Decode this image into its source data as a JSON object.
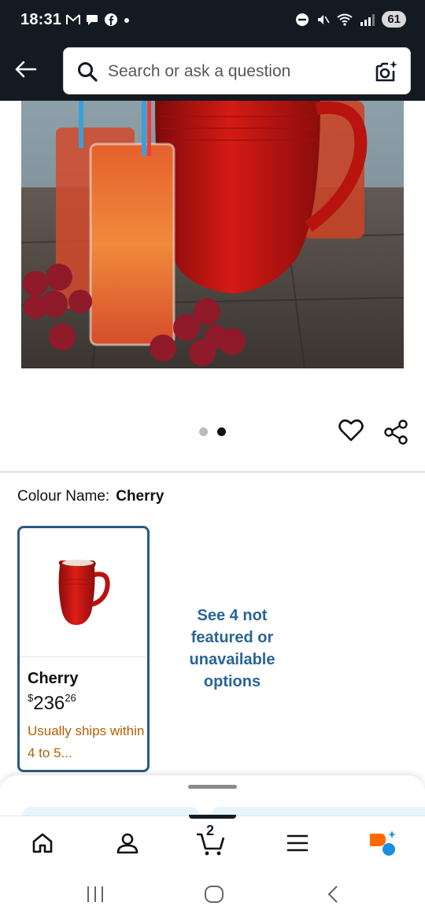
{
  "status_bar": {
    "time": "18:31",
    "battery": "61",
    "left_icons": [
      "gmail-icon",
      "chat-icon",
      "facebook-icon",
      "dot-icon"
    ],
    "right_icons": [
      "dnd-icon",
      "mute-icon",
      "wifi-icon",
      "signal-icon"
    ]
  },
  "header": {
    "search_placeholder": "Search or ask a question",
    "back_icon": "back-arrow-icon",
    "search_icon": "search-icon",
    "camera_icon": "camera-search-icon"
  },
  "carousel": {
    "total_images": 2,
    "active_index": 1
  },
  "colour": {
    "label": "Colour Name:",
    "value": "Cherry"
  },
  "variant": {
    "name": "Cherry",
    "currency": "$",
    "price_whole": "236",
    "price_fraction": "26",
    "shipping": "Usually ships within 4 to 5..."
  },
  "see_more": "See 4 not featured or unavailable options",
  "bottom_nav": {
    "items": [
      "home-icon",
      "account-icon",
      "cart-icon",
      "menu-icon",
      "rufus-icon"
    ],
    "cart_count": "2",
    "active": "cart"
  },
  "colors": {
    "header_bg": "#131a22",
    "accent_link": "#2a6496",
    "ship_text": "#b85c00",
    "selected_border": "#2a5b84"
  }
}
